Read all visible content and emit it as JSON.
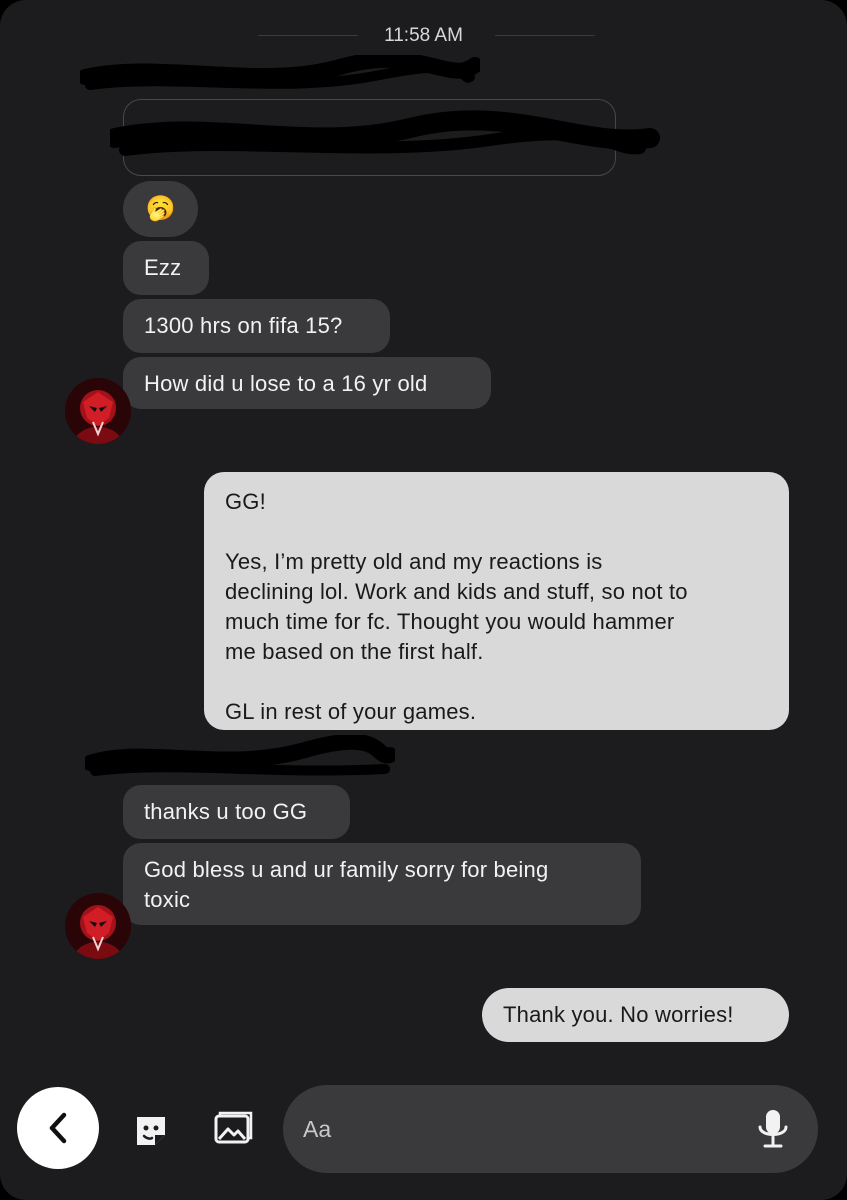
{
  "header": {
    "time": "11:58 AM"
  },
  "messages": {
    "emoji": "🥱",
    "m1": "Ezz",
    "m2": "1300 hrs on fifa 15?",
    "m3": "How did u lose to a 16 yr old",
    "sent1_p1": "GG!",
    "sent1_p2_l1": "Yes, I’m pretty old and my reactions is",
    "sent1_p2_l2": "declining lol. Work and kids and stuff, so not to",
    "sent1_p2_l3": "much time for fc. Thought you would hammer",
    "sent1_p2_l4": "me based on the first half.",
    "sent1_p3": "GL in rest of your games.",
    "m4": "thanks u too GG",
    "m5_l1": "God bless u and ur family sorry for being",
    "m5_l2": "toxic",
    "sent2": "Thank you. No worries!"
  },
  "composer": {
    "placeholder": "Aa"
  },
  "icons": {
    "back": "chevron-left-icon",
    "sticker": "sticker-icon",
    "gallery": "gallery-icon",
    "mic": "microphone-icon"
  },
  "colors": {
    "background": "#1c1c1e",
    "received_bubble": "#3a3a3c",
    "sent_bubble": "#d9d9d9"
  }
}
